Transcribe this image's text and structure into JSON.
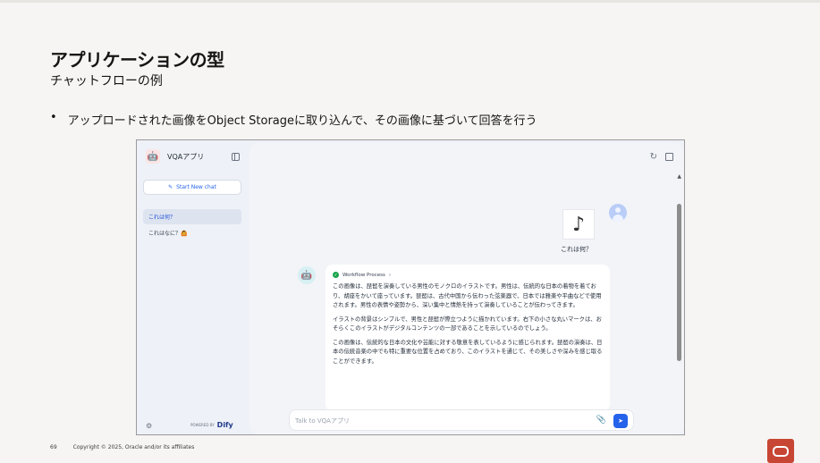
{
  "slide": {
    "title": "アプリケーションの型",
    "subtitle": "チャットフローの例",
    "bullet": "アップロードされた画像をObject Storageに取り込んで、その画像に基づいて回答を行う",
    "page_number": "69",
    "copyright": "Copyright © 2025, Oracle and/or its affiliates"
  },
  "app": {
    "name": "VQAアプリ",
    "new_chat_label": "Start New chat",
    "conversations": [
      {
        "label": "これは何？",
        "active": true
      },
      {
        "label": "これはなに？🙆",
        "active": false
      }
    ],
    "powered_by": "POWERED BY",
    "brand": "Dify",
    "user_message": "これは何？",
    "workflow_label": "Workflow Process",
    "answer_paragraphs": [
      "この画像は、琵琶を演奏している男性のモノクロのイラストです。男性は、伝統的な日本の着物を着ており、胡座をかいて座っています。琵琶は、古代中国から伝わった弦楽器で、日本では雅楽や平曲などで使用されます。男性の表情や姿勢から、深い集中と情熱を持って演奏していることが伝わってきます。",
      "イラストの背景はシンプルで、男性と琵琶が際立つように描かれています。右下の小さな丸いマークは、おそらくこのイラストがデジタルコンテンツの一部であることを示しているのでしょう。",
      "この画像は、伝統的な日本の文化や芸能に対する敬意を表しているように感じられます。琵琶の演奏は、日本の伝統音楽の中でも特に重要な位置を占めており、このイラストを通じて、その美しさや深みを感じ取ることができます。"
    ],
    "input_placeholder": "Talk to VQAアプリ"
  },
  "colors": {
    "accent": "#2563eb",
    "oracle_red": "#c74634"
  }
}
